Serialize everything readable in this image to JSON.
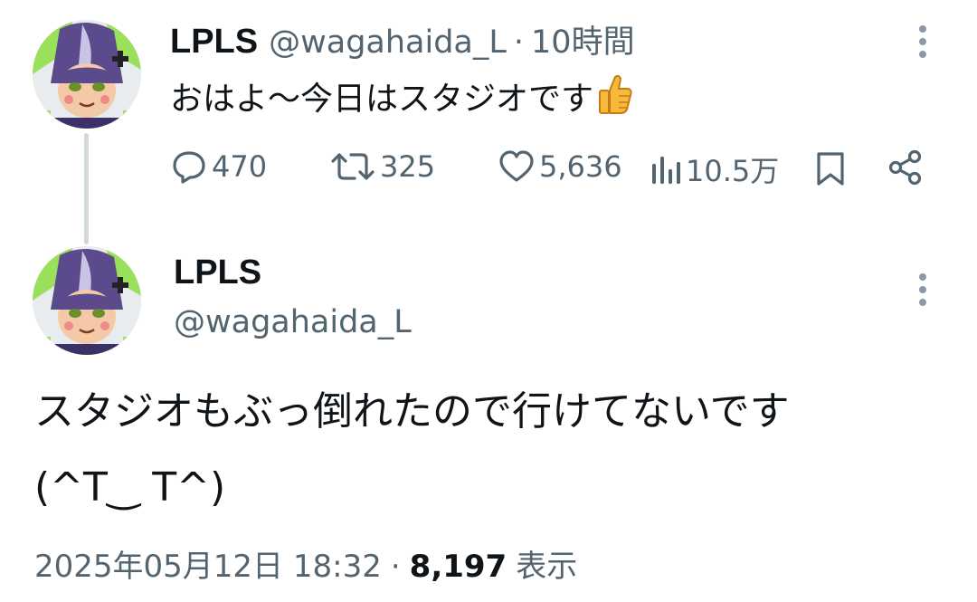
{
  "reply_parent": {
    "name": "LPLS",
    "handle": "@wagahaida_L",
    "separator": "·",
    "time": "10時間",
    "text": "おはよ〜今日はスタジオです",
    "emoji": "👍",
    "actions": {
      "reply_count": "470",
      "retweet_count": "325",
      "like_count": "5,636",
      "view_count": "10.5万"
    }
  },
  "main_tweet": {
    "name": "LPLS",
    "handle": "@wagahaida_L",
    "text_line1": "スタジオもぶっ倒れたので行けてないです",
    "text_line2": "(^T‿ T^)",
    "date": "2025年05月12日 18:32",
    "separator": "·",
    "views_count": "8,197",
    "views_label": "表示"
  },
  "colors": {
    "primary_text": "#0f1419",
    "secondary_text": "#536471",
    "thread_line": "#cfd9de",
    "avatar_green": "#8ddc4e",
    "avatar_purple": "#5a4a8a"
  },
  "icons": [
    "avatar",
    "more-icon",
    "reply-icon",
    "retweet-icon",
    "like-icon",
    "views-icon",
    "bookmark-icon",
    "share-icon",
    "thumbs-up-emoji"
  ]
}
